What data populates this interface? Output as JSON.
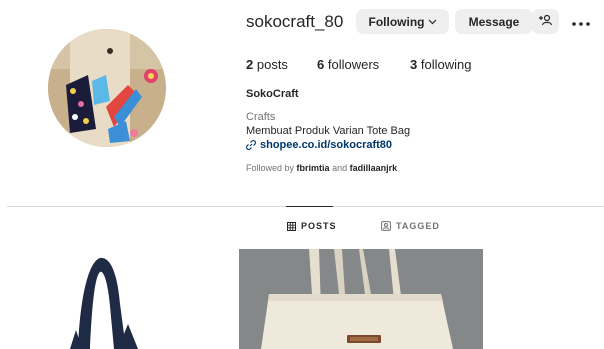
{
  "profile": {
    "username": "sokocraft_80",
    "full_name": "SokoCraft",
    "category": "Crafts",
    "bio": "Membuat Produk Varian Tote Bag",
    "link": "shopee.co.id/sokocraft80"
  },
  "actions": {
    "following_label": "Following",
    "message_label": "Message"
  },
  "stats": {
    "posts_count": "2",
    "posts_label": "posts",
    "followers_count": "6",
    "followers_label": "followers",
    "following_count": "3",
    "following_label": "following"
  },
  "followed_by": {
    "prefix": "Followed by",
    "user1": "fbrimtia",
    "joiner": "and",
    "user2": "fadillaanjrk"
  },
  "tabs": {
    "posts": "POSTS",
    "tagged": "TAGGED"
  },
  "icons": {
    "following_chevron": "chevron-down-icon",
    "add_user": "add-user-icon",
    "more": "more-options-icon",
    "link": "link-icon",
    "posts_tab": "grid-icon",
    "tagged_tab": "tag-icon"
  },
  "colors": {
    "link": "#00376b",
    "button_bg": "#efefef",
    "muted_text": "#737373"
  }
}
